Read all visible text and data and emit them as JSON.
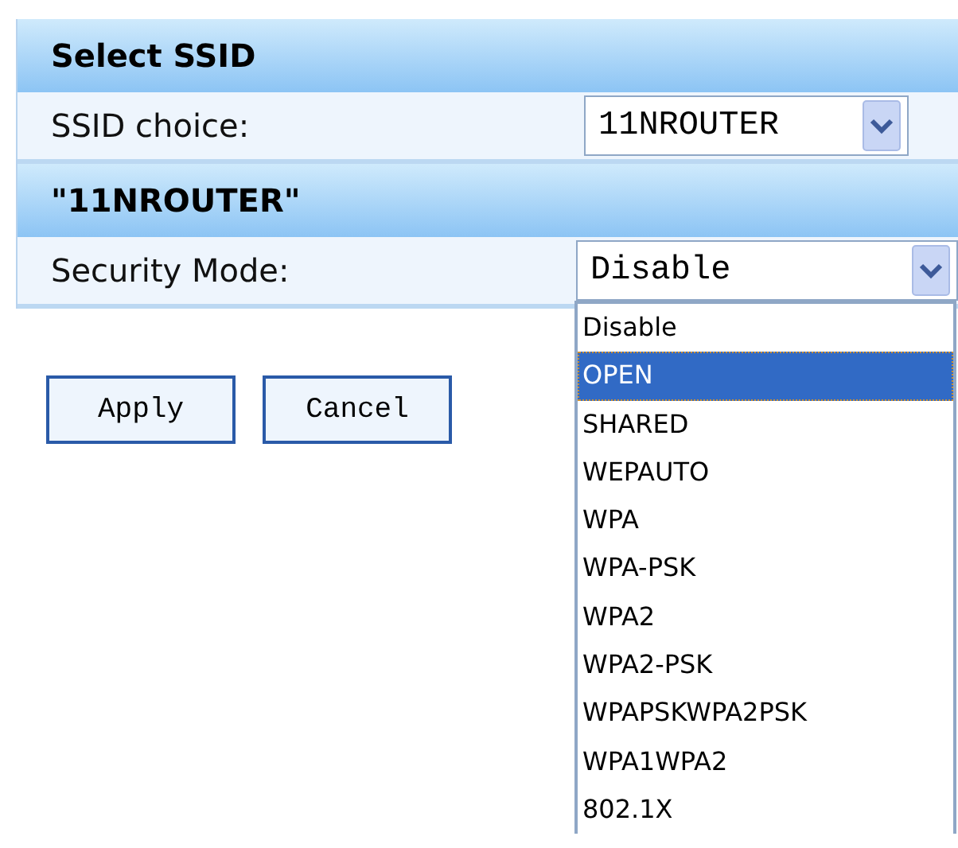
{
  "sections": [
    {
      "heading": "Select SSID",
      "field": {
        "label": "SSID choice:",
        "value": "11NROUTER",
        "open": false
      }
    },
    {
      "heading": "\"11NROUTER\"",
      "field": {
        "label": "Security Mode:",
        "value": "Disable",
        "open": true
      }
    }
  ],
  "buttons": [
    "Apply",
    "Cancel"
  ],
  "dropdown": [
    {
      "label": "Disable",
      "selected": false
    },
    {
      "label": "OPEN",
      "selected": true
    },
    {
      "label": "SHARED",
      "selected": false
    },
    {
      "label": "WEPAUTO",
      "selected": false
    },
    {
      "label": "WPA",
      "selected": false
    },
    {
      "label": "WPA-PSK",
      "selected": false
    },
    {
      "label": "WPA2",
      "selected": false
    },
    {
      "label": "WPA2-PSK",
      "selected": false
    },
    {
      "label": "WPAPSKWPA2PSK",
      "selected": false
    },
    {
      "label": "WPA1WPA2",
      "selected": false
    },
    {
      "label": "802.1X",
      "selected": false
    }
  ]
}
